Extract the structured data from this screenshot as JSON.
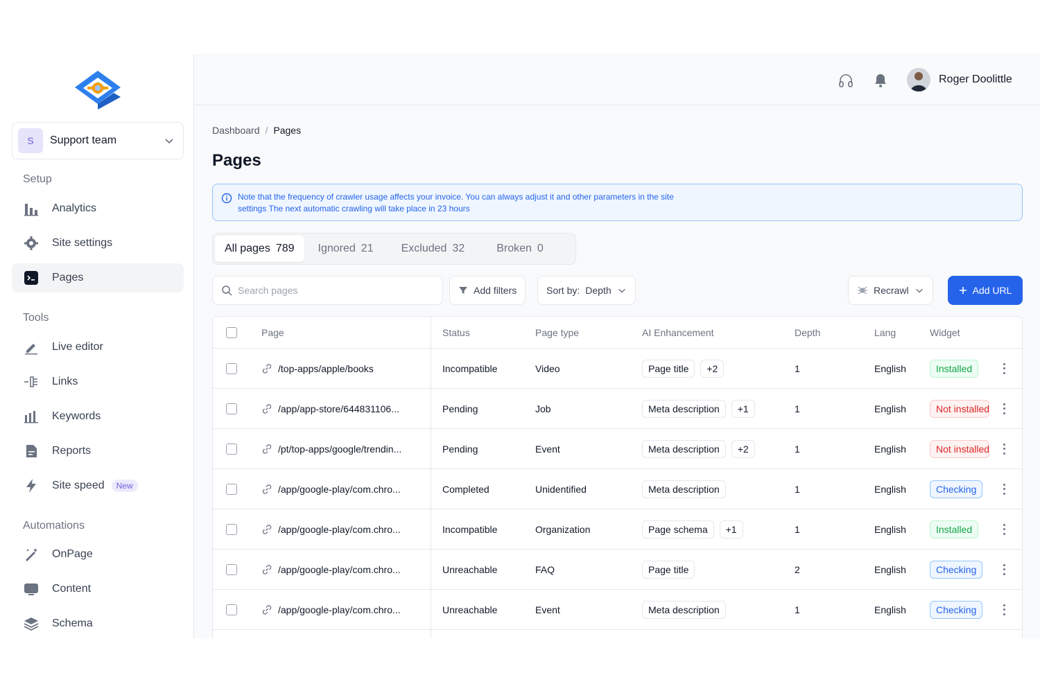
{
  "user": {
    "name": "Roger Doolittle"
  },
  "team": {
    "avatar_letter": "S",
    "name": "Support team"
  },
  "sidebar": {
    "sections": [
      {
        "label": "Setup",
        "items": [
          {
            "label": "Analytics",
            "icon": "bar-chart-icon"
          },
          {
            "label": "Site settings",
            "icon": "gear-icon"
          },
          {
            "label": "Pages",
            "icon": "terminal-icon",
            "active": true
          }
        ]
      },
      {
        "label": "Tools",
        "items": [
          {
            "label": "Live editor",
            "icon": "pen-icon"
          },
          {
            "label": "Links",
            "icon": "links-icon"
          },
          {
            "label": "Keywords",
            "icon": "keywords-icon"
          },
          {
            "label": "Reports",
            "icon": "report-icon"
          },
          {
            "label": "Site speed",
            "icon": "lightning-icon",
            "badge": "New"
          }
        ]
      },
      {
        "label": "Automations",
        "items": [
          {
            "label": "OnPage",
            "icon": "magic-wand-icon"
          },
          {
            "label": "Content",
            "icon": "content-icon"
          },
          {
            "label": "Schema",
            "icon": "layers-icon"
          }
        ]
      }
    ]
  },
  "breadcrumb": {
    "root": "Dashboard",
    "separator": "/",
    "current": "Pages"
  },
  "page_title": "Pages",
  "notice": {
    "text": "Note that the frequency of crawler usage affects your invoice. You can always adjust it and other parameters in the site settings The next automatic crawling will take place in 23 hours"
  },
  "tabs": [
    {
      "label": "All pages",
      "count": "789",
      "active": true
    },
    {
      "label": "Ignored",
      "count": "21"
    },
    {
      "label": "Excluded",
      "count": "32"
    },
    {
      "label": "Broken",
      "count": "0"
    }
  ],
  "toolbar": {
    "search_placeholder": "Search pages",
    "add_filters": "Add filters",
    "sort_label": "Sort by:",
    "sort_value": "Depth",
    "recrawl": "Recrawl",
    "add_url": "Add URL"
  },
  "table": {
    "headers": {
      "page": "Page",
      "status": "Status",
      "page_type": "Page type",
      "ai": "AI Enhancement",
      "depth": "Depth",
      "lang": "Lang",
      "widget": "Widget"
    },
    "rows": [
      {
        "page": "/top-apps/apple/books",
        "status": "Incompatible",
        "page_type": "Video",
        "ai": "Page title",
        "ai_extra": "+2",
        "depth": "1",
        "lang": "English",
        "widget": "Installed",
        "widget_kind": "installed"
      },
      {
        "page": "/app/app-store/644831106...",
        "status": "Pending",
        "page_type": "Job",
        "ai": "Meta description",
        "ai_extra": "+1",
        "depth": "1",
        "lang": "English",
        "widget": "Not installed",
        "widget_kind": "notinstalled"
      },
      {
        "page": "/pt/top-apps/google/trendin...",
        "status": "Pending",
        "page_type": "Event",
        "ai": "Meta description",
        "ai_extra": "+2",
        "depth": "1",
        "lang": "English",
        "widget": "Not installed",
        "widget_kind": "notinstalled"
      },
      {
        "page": "/app/google-play/com.chro...",
        "status": "Completed",
        "page_type": "Unidentified",
        "ai": "Meta description",
        "ai_extra": "",
        "depth": "1",
        "lang": "English",
        "widget": "Checking",
        "widget_kind": "checking"
      },
      {
        "page": "/app/google-play/com.chro...",
        "status": "Incompatible",
        "page_type": "Organization",
        "ai": "Page schema",
        "ai_extra": "+1",
        "depth": "1",
        "lang": "English",
        "widget": "Installed",
        "widget_kind": "installed"
      },
      {
        "page": "/app/google-play/com.chro...",
        "status": "Unreachable",
        "page_type": "FAQ",
        "ai": "Page title",
        "ai_extra": "",
        "depth": "2",
        "lang": "English",
        "widget": "Checking",
        "widget_kind": "checking"
      },
      {
        "page": "/app/google-play/com.chro...",
        "status": "Unreachable",
        "page_type": "Event",
        "ai": "Meta description",
        "ai_extra": "",
        "depth": "1",
        "lang": "English",
        "widget": "Checking",
        "widget_kind": "checking"
      }
    ]
  },
  "colors": {
    "primary": "#2563eb",
    "brand_orange": "#f59e0b",
    "brand_blue": "#2f80ed"
  }
}
